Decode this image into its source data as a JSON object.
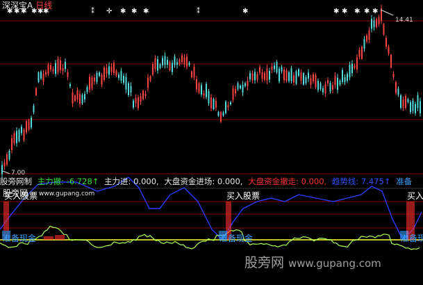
{
  "header": {
    "title": "深深宝A",
    "period": "日线"
  },
  "price_axis": {
    "max_label": "14.41",
    "min_label": "7.00"
  },
  "indicator_bar": {
    "name": "股旁网制",
    "items": [
      {
        "label": "主力撤: -6.728↑",
        "color": "#33dd33"
      },
      {
        "label": "主力进: 0.000,",
        "color": "#e8e8e8"
      },
      {
        "label": "大盘资金进场: 0.000,",
        "color": "#e8e8e8"
      },
      {
        "label": "大盘资金撤走: 0.000,",
        "color": "#ff3030"
      },
      {
        "label": "趋势线: 7.475↑",
        "color": "#3050ff"
      },
      {
        "label": "准备",
        "color": "#3aa0ff"
      }
    ]
  },
  "sub_panel": {
    "site_label": "股旁网",
    "site_url": "www.gupang.com",
    "buy_label": "买入股票",
    "prepare_label": "准备现金"
  },
  "watermark": {
    "text": "股旁网",
    "url": "www.gupang.com"
  },
  "colors": {
    "up": "#ff4444",
    "down": "#55dddd",
    "trend": "#2a3cff",
    "yellow_line": "#ffff33",
    "fast_line": "#aaff55",
    "grid": "#8b0000",
    "buy_bar": "#ff3030",
    "prep_bar": "#3a9cff"
  }
}
